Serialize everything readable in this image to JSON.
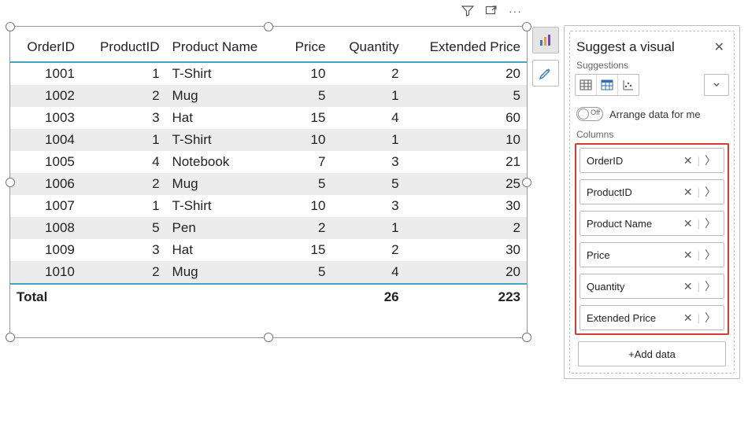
{
  "chart_data": {
    "type": "table",
    "columns": [
      "OrderID",
      "ProductID",
      "Product Name",
      "Price",
      "Quantity",
      "Extended Price"
    ],
    "rows": [
      {
        "OrderID": 1001,
        "ProductID": 1,
        "Product Name": "T-Shirt",
        "Price": 10,
        "Quantity": 2,
        "Extended Price": 20
      },
      {
        "OrderID": 1002,
        "ProductID": 2,
        "Product Name": "Mug",
        "Price": 5,
        "Quantity": 1,
        "Extended Price": 5
      },
      {
        "OrderID": 1003,
        "ProductID": 3,
        "Product Name": "Hat",
        "Price": 15,
        "Quantity": 4,
        "Extended Price": 60
      },
      {
        "OrderID": 1004,
        "ProductID": 1,
        "Product Name": "T-Shirt",
        "Price": 10,
        "Quantity": 1,
        "Extended Price": 10
      },
      {
        "OrderID": 1005,
        "ProductID": 4,
        "Product Name": "Notebook",
        "Price": 7,
        "Quantity": 3,
        "Extended Price": 21
      },
      {
        "OrderID": 1006,
        "ProductID": 2,
        "Product Name": "Mug",
        "Price": 5,
        "Quantity": 5,
        "Extended Price": 25
      },
      {
        "OrderID": 1007,
        "ProductID": 1,
        "Product Name": "T-Shirt",
        "Price": 10,
        "Quantity": 3,
        "Extended Price": 30
      },
      {
        "OrderID": 1008,
        "ProductID": 5,
        "Product Name": "Pen",
        "Price": 2,
        "Quantity": 1,
        "Extended Price": 2
      },
      {
        "OrderID": 1009,
        "ProductID": 3,
        "Product Name": "Hat",
        "Price": 15,
        "Quantity": 2,
        "Extended Price": 30
      },
      {
        "OrderID": 1010,
        "ProductID": 2,
        "Product Name": "Mug",
        "Price": 5,
        "Quantity": 4,
        "Extended Price": 20
      }
    ],
    "totals": {
      "label": "Total",
      "Quantity": 26,
      "Extended Price": 223
    }
  },
  "headers": {
    "OrderID": "OrderID",
    "ProductID": "ProductID",
    "ProductName": "Product Name",
    "Price": "Price",
    "Quantity": "Quantity",
    "ExtendedPrice": "Extended Price"
  },
  "pane": {
    "title": "Suggest a visual",
    "suggestions_label": "Suggestions",
    "arrange_label": "Arrange data for me",
    "arrange_state": "Off",
    "columns_label": "Columns",
    "fields": [
      "OrderID",
      "ProductID",
      "Product Name",
      "Price",
      "Quantity",
      "Extended Price"
    ],
    "add_data_label": "+Add data"
  }
}
